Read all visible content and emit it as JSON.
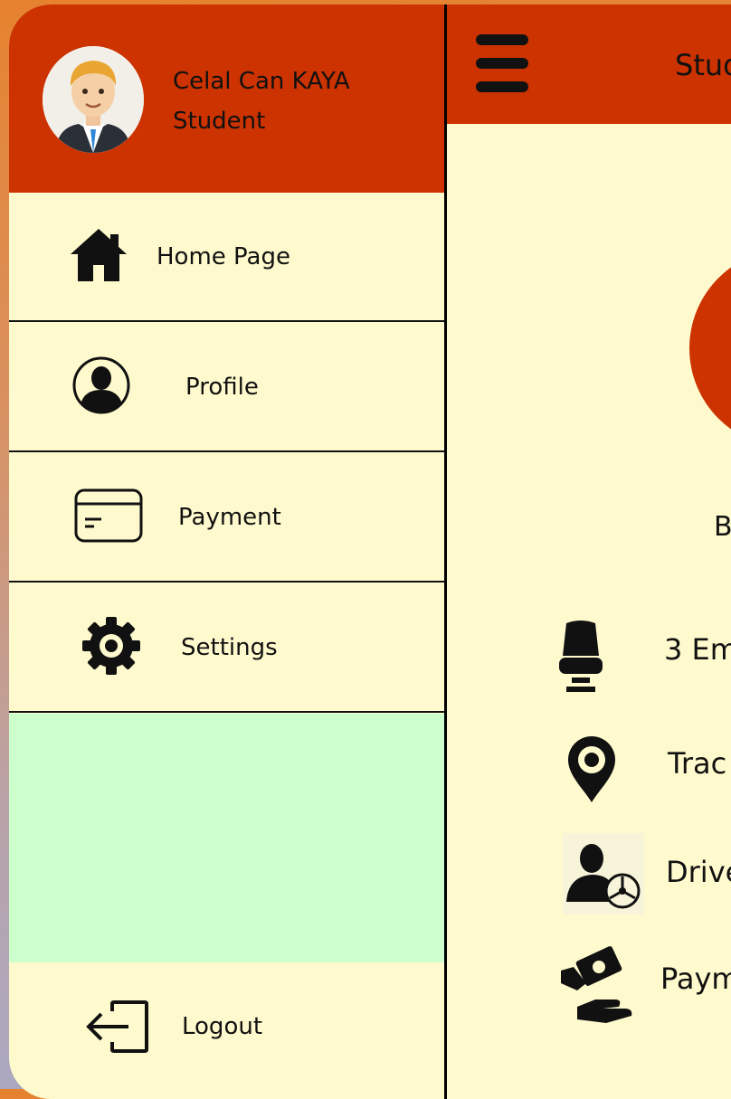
{
  "user": {
    "name": "Celal Can KAYA",
    "role": "Student"
  },
  "menu": {
    "home": "Home Page",
    "profile": "Profile",
    "payment": "Payment",
    "settings": "Settings",
    "logout": "Logout"
  },
  "main": {
    "title_partial": "Stud",
    "circle_caption_partial": "B",
    "features": [
      {
        "label": "3 Em",
        "icon": "seat-icon"
      },
      {
        "label": "Trac",
        "icon": "location-pin-icon"
      },
      {
        "label": "Drive",
        "icon": "driver-icon"
      },
      {
        "label": "Paym",
        "icon": "payment-hand-icon"
      }
    ]
  },
  "colors": {
    "accent": "#cc3300",
    "panel": "#fffacd",
    "highlight": "#ccffcc"
  }
}
